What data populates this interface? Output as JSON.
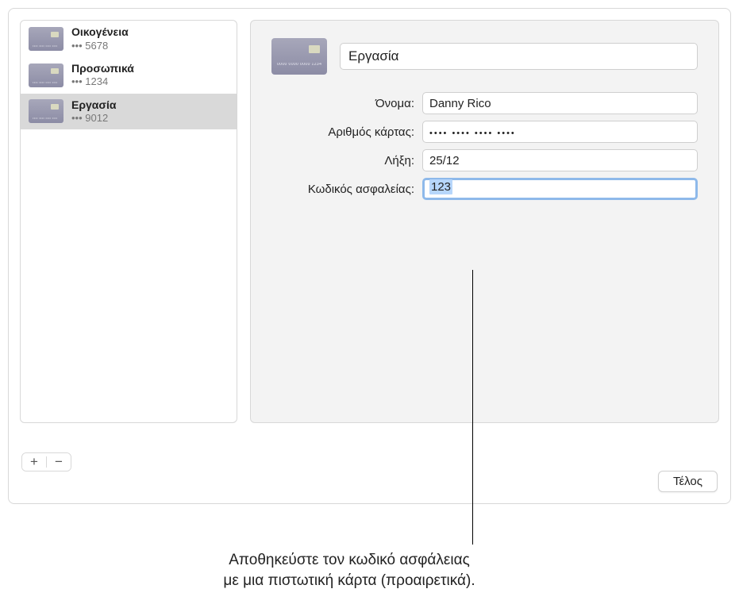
{
  "sidebar": {
    "items": [
      {
        "label": "Οικογένεια",
        "sub": "••• 5678"
      },
      {
        "label": "Προσωπικά",
        "sub": "••• 1234"
      },
      {
        "label": "Εργασία",
        "sub": "••• 9012"
      }
    ],
    "selected_index": 2
  },
  "detail": {
    "title_value": "Εργασία",
    "labels": {
      "name": "Όνομα:",
      "card_number": "Αριθμός κάρτας:",
      "expiry": "Λήξη:",
      "security_code": "Κωδικός ασφαλείας:"
    },
    "values": {
      "name": "Danny Rico",
      "card_number_masked": "•••• •••• •••• ••••",
      "expiry": "25/12",
      "security_code": "123"
    }
  },
  "buttons": {
    "add": "+",
    "remove": "−",
    "done": "Τέλος"
  },
  "callout": {
    "line1": "Αποθηκεύστε τον κωδικό ασφάλειας",
    "line2": "με μια πιστωτική κάρτα (προαιρετικά)."
  }
}
